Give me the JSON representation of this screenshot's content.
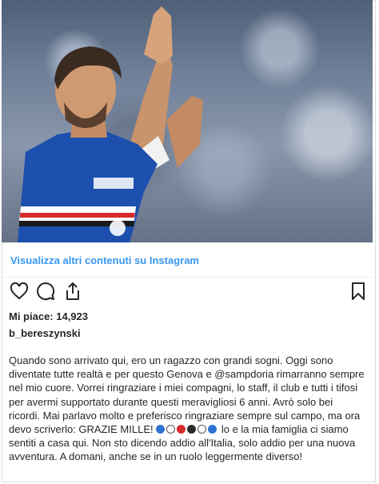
{
  "post": {
    "image_alt": "Calciatore della Sampdoria che applaude",
    "view_more_link": "Visualizza altri contenuti su Instagram",
    "likes_text": "Mi piace: 14,923",
    "username": "b_bereszynski",
    "caption_before_emoji": "Quando sono arrivato qui, ero un ragazzo con grandi sogni. Oggi sono diventate tutte realtà e per questo Genova e @sampdoria rimarranno sempre nel mio cuore. Vorrei ringraziare i miei compagni, lo staff, il club e tutti i tifosi per avermi supportato durante questi meravigliosi 6 anni. Avrò solo bei ricordi. Mai parlavo molto e preferisco ringraziare sempre sul campo, ma ora devo scriverlo: GRAZIE MILLE! ",
    "emoji_colors": [
      "#2f74d0",
      "#ffffff",
      "#d62b2b",
      "#2b2b2b",
      "#ffffff",
      "#2f74d0"
    ],
    "caption_after_emoji": " lo e la mia famiglia ci siamo sentiti a casa qui. Non sto dicendo addio all'Italia, solo addio per una nuova avventura. A domani, anche se in un ruolo leggermente diverso!"
  },
  "icons": {
    "like": "heart-icon",
    "comment": "comment-icon",
    "share": "share-icon",
    "save": "bookmark-icon"
  }
}
